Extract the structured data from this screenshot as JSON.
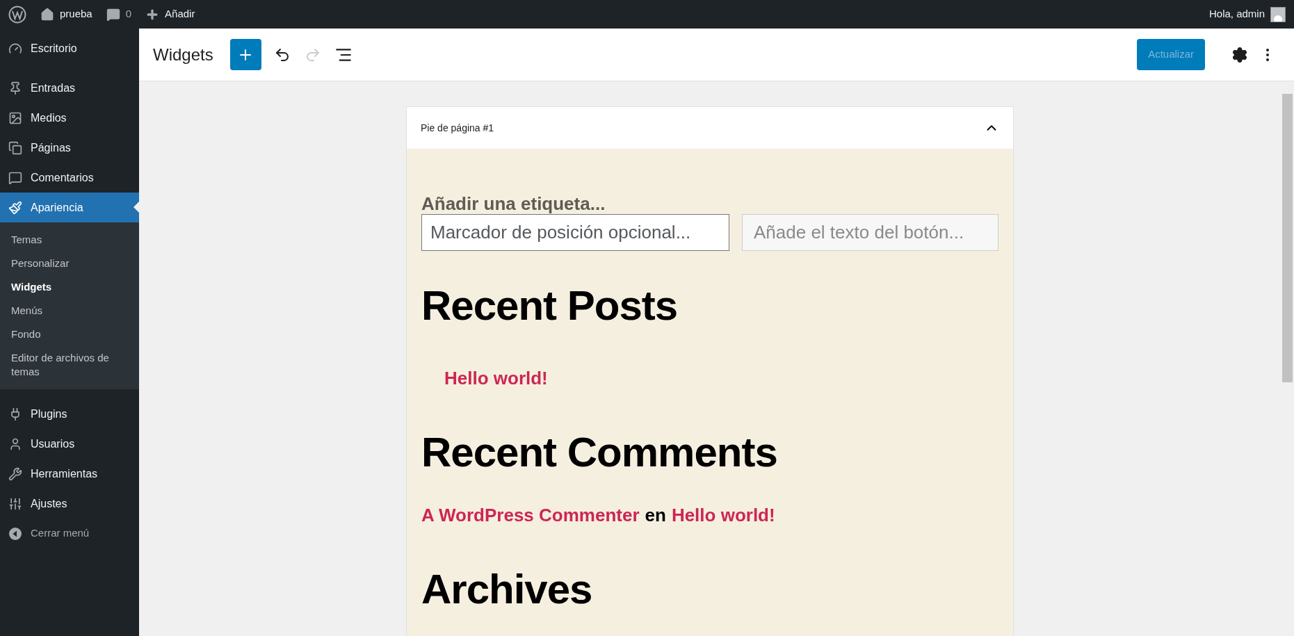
{
  "admin_bar": {
    "site": "prueba",
    "comments": "0",
    "new": "Añadir",
    "greeting": "Hola, admin"
  },
  "sidebar": {
    "items": [
      {
        "label": "Escritorio",
        "selected": false
      },
      {
        "label": "Entradas",
        "selected": false
      },
      {
        "label": "Medios",
        "selected": false
      },
      {
        "label": "Páginas",
        "selected": false
      },
      {
        "label": "Comentarios",
        "selected": false
      },
      {
        "label": "Apariencia",
        "selected": true,
        "children": [
          {
            "label": "Temas",
            "selected": false
          },
          {
            "label": "Personalizar",
            "selected": false
          },
          {
            "label": "Widgets",
            "selected": true
          },
          {
            "label": "Menús",
            "selected": false
          },
          {
            "label": "Fondo",
            "selected": false
          },
          {
            "label": "Editor de archivos de temas",
            "selected": false
          }
        ]
      },
      {
        "label": "Plugins",
        "selected": false
      },
      {
        "label": "Usuarios",
        "selected": false
      },
      {
        "label": "Herramientas",
        "selected": false
      },
      {
        "label": "Ajustes",
        "selected": false
      }
    ],
    "collapse": "Cerrar menú"
  },
  "editor": {
    "title": "Widgets",
    "undo_disabled": false,
    "redo_disabled": true,
    "update_button": {
      "label": "Actualizar",
      "disabled": true
    }
  },
  "widget_area": {
    "title": "Pie de página #1",
    "expanded": true,
    "search": {
      "label": "Añadir una etiqueta...",
      "placeholder": "Marcador de posición opcional...",
      "button_placeholder": "Añade el texto del botón..."
    },
    "recent_posts": {
      "heading": "Recent Posts",
      "posts": [
        "Hello world!"
      ]
    },
    "recent_comments": {
      "heading": "Recent Comments",
      "comments": [
        {
          "author": "A WordPress Commenter",
          "joiner": "en",
          "post": "Hello world!"
        }
      ]
    },
    "archives": {
      "heading": "Archives"
    }
  }
}
